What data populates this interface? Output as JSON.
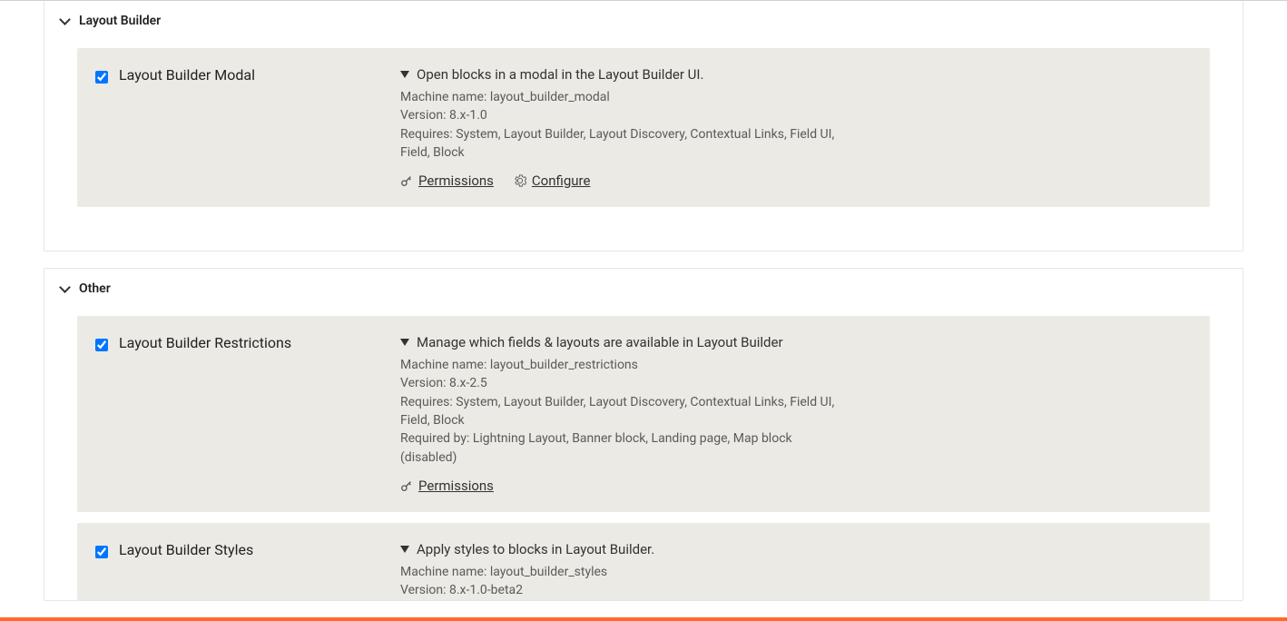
{
  "sections": [
    {
      "title": "Layout Builder",
      "modules": [
        {
          "name": "Layout Builder Modal",
          "checked": true,
          "description": "Open blocks in a modal in the Layout Builder UI.",
          "machine_name_label": "Machine name: ",
          "machine_name": "layout_builder_modal",
          "version_label": "Version: ",
          "version": "8.x-1.0",
          "requires_label": "Requires: ",
          "requires": "System, Layout Builder, Layout Discovery, Contextual Links, Field UI, Field, Block",
          "links": {
            "permissions": "Permissions",
            "configure": "Configure"
          }
        }
      ]
    },
    {
      "title": "Other",
      "modules": [
        {
          "name": "Layout Builder Restrictions",
          "checked": true,
          "description": "Manage which fields & layouts are available in Layout Builder",
          "machine_name_label": "Machine name: ",
          "machine_name": "layout_builder_restrictions",
          "version_label": "Version: ",
          "version": "8.x-2.5",
          "requires_label": "Requires: ",
          "requires": "System, Layout Builder, Layout Discovery, Contextual Links, Field UI, Field, Block",
          "required_by_label": "Required by: ",
          "required_by": "Lightning Layout, Banner block, Landing page, Map block (disabled)",
          "links": {
            "permissions": "Permissions"
          }
        },
        {
          "name": "Layout Builder Styles",
          "checked": true,
          "description": "Apply styles to blocks in Layout Builder.",
          "machine_name_label": "Machine name: ",
          "machine_name": "layout_builder_styles",
          "version_label": "Version: ",
          "version": "8.x-1.0-beta2",
          "links": {}
        }
      ]
    }
  ]
}
